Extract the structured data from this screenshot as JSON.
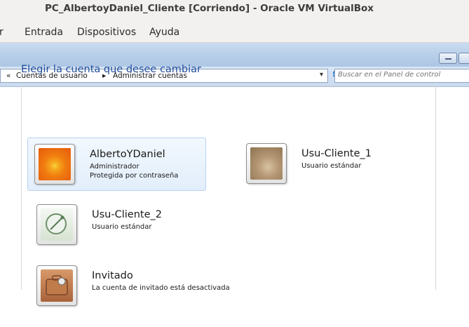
{
  "host": {
    "title": "PC_AlbertoyDaniel_Cliente [Corriendo] - Oracle VM VirtualBox",
    "menu": [
      "r",
      "Entrada",
      "Dispositivos",
      "Ayuda"
    ]
  },
  "address_bar": {
    "crumb_prefix": "«",
    "crumbs": [
      "Cuentas de usuario",
      "Administrar cuentas"
    ],
    "separator": "▸",
    "dropdown": "▾",
    "refresh_icon": "refresh-icon"
  },
  "search": {
    "placeholder": "Buscar en el Panel de control"
  },
  "page": {
    "heading": "Elegir la cuenta que desee cambiar"
  },
  "accounts": [
    {
      "name": "AlbertoYDaniel",
      "line1": "Administrador",
      "line2": "Protegida por contraseña",
      "picture": "flower-picture",
      "selected": true
    },
    {
      "name": "Usu-Cliente_1",
      "line1": "Usuario estándar",
      "line2": "",
      "picture": "cat-picture",
      "selected": false
    },
    {
      "name": "Usu-Cliente_2",
      "line1": "Usuario estándar",
      "line2": "",
      "picture": "satellite-dish-picture",
      "selected": false
    },
    {
      "name": "Invitado",
      "line1": "La cuenta de invitado está desactivada",
      "line2": "",
      "picture": "guest-suitcase-picture",
      "selected": false
    }
  ],
  "colors": {
    "heading": "#1e4c9c",
    "selected_bg": "#e2eefb",
    "toolbar": "#b5cde8"
  }
}
